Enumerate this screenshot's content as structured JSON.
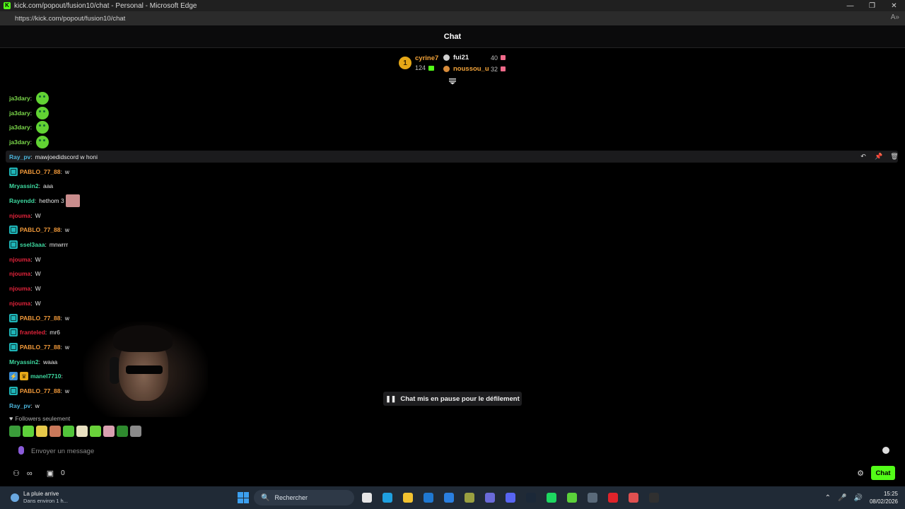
{
  "window": {
    "title": "kick.com/popout/fusion10/chat - Personal - Microsoft Edge",
    "favicon_letter": "K",
    "controls": [
      "—",
      "❐",
      "✕"
    ]
  },
  "address_bar": {
    "url": "https://kick.com/popout/fusion10/chat",
    "reader_icon": "A»"
  },
  "chat_header": {
    "title": "Chat"
  },
  "leaderboard": {
    "first": {
      "rank": "1",
      "name": "cyrine7",
      "count": "124"
    },
    "others": [
      {
        "name": "fui21",
        "count": "40",
        "icon_color": "#cfcfcf"
      },
      {
        "name": "noussou_u",
        "count": "32",
        "icon_color": "#d98c3a"
      }
    ]
  },
  "messages": [
    {
      "user": "ja3dary",
      "color": "#7bd84a",
      "badges": [],
      "text": "",
      "emote": "frog"
    },
    {
      "user": "ja3dary",
      "color": "#7bd84a",
      "badges": [],
      "text": "",
      "emote": "frog"
    },
    {
      "user": "ja3dary",
      "color": "#7bd84a",
      "badges": [],
      "text": "",
      "emote": "frog"
    },
    {
      "user": "ja3dary",
      "color": "#7bd84a",
      "badges": [],
      "text": "",
      "emote": "frog"
    },
    {
      "user": "Ray_pv",
      "color": "#4ab3d9",
      "badges": [],
      "text": "mawjoedidscord w honi",
      "emote": ""
    },
    {
      "user": "PABLO_77_88",
      "color": "#f29a3a",
      "badges": [
        "sub"
      ],
      "text": "w",
      "emote": ""
    },
    {
      "user": "Mryassin2",
      "color": "#3ed9a0",
      "badges": [],
      "text": "aaa",
      "emote": ""
    },
    {
      "user": "Rayendd",
      "color": "#3ed9a0",
      "badges": [],
      "text": "hethom 3",
      "emote": "pink"
    },
    {
      "user": "njouma",
      "color": "#e0233a",
      "badges": [],
      "text": "W",
      "emote": ""
    },
    {
      "user": "PABLO_77_88",
      "color": "#f29a3a",
      "badges": [
        "sub"
      ],
      "text": "w",
      "emote": ""
    },
    {
      "user": "ssel3aaa",
      "color": "#3ed9a0",
      "badges": [
        "sub"
      ],
      "text": "mnwrrr",
      "emote": ""
    },
    {
      "user": "njouma",
      "color": "#e0233a",
      "badges": [],
      "text": "W",
      "emote": ""
    },
    {
      "user": "njouma",
      "color": "#e0233a",
      "badges": [],
      "text": "W",
      "emote": ""
    },
    {
      "user": "njouma",
      "color": "#e0233a",
      "badges": [],
      "text": "W",
      "emote": ""
    },
    {
      "user": "njouma",
      "color": "#e0233a",
      "badges": [],
      "text": "W",
      "emote": ""
    },
    {
      "user": "PABLO_77_88",
      "color": "#f29a3a",
      "badges": [
        "sub"
      ],
      "text": "w",
      "emote": ""
    },
    {
      "user": "franteled",
      "color": "#e0233a",
      "badges": [
        "sub"
      ],
      "text": "mr6",
      "emote": ""
    },
    {
      "user": "PABLO_77_88",
      "color": "#f29a3a",
      "badges": [
        "sub"
      ],
      "text": "w",
      "emote": ""
    },
    {
      "user": "Mryassin2",
      "color": "#3ed9a0",
      "badges": [],
      "text": "waaa",
      "emote": ""
    },
    {
      "user": "manel7710",
      "color": "#3ed9a0",
      "badges": [
        "boost",
        "crown"
      ],
      "text": "",
      "emote": ""
    },
    {
      "user": "PABLO_77_88",
      "color": "#f29a3a",
      "badges": [
        "sub"
      ],
      "text": "w",
      "emote": ""
    },
    {
      "user": "Ray_pv",
      "color": "#4ab3d9",
      "badges": [],
      "text": "w",
      "emote": ""
    }
  ],
  "message_tools": [
    "↶",
    "📌",
    "🗑"
  ],
  "paused": {
    "icon": "❚❚",
    "label": "Chat mis en pause pour le défilement"
  },
  "followers": {
    "icon": "♥",
    "label": "Followers seulement"
  },
  "emote_strip_colors": [
    "#3a9c3a",
    "#5ed13a",
    "#e6c84a",
    "#c9785a",
    "#52c43a",
    "#e8e0c0",
    "#6ad13a",
    "#d9a0b0",
    "#2e8a2e",
    "#8a8a8a"
  ],
  "input": {
    "placeholder": "Envoyer un message",
    "value": ""
  },
  "bottom_bar": {
    "icon_left": "⚇",
    "infinity": "∞",
    "gift_icon": "▣",
    "gift_count": "0",
    "settings_icon": "⚙",
    "chat_button": "Chat"
  },
  "taskbar": {
    "weather": {
      "line1": "La pluie arrive",
      "line2": "Dans environ 1 h..."
    },
    "search_placeholder": "Rechercher",
    "search_icon": "🔍",
    "apps": [
      {
        "name": "task-view",
        "color": "#e6e6e6"
      },
      {
        "name": "edge",
        "color": "#1fa0e0"
      },
      {
        "name": "file-explorer",
        "color": "#f2c230"
      },
      {
        "name": "outlook",
        "color": "#1f78d1"
      },
      {
        "name": "store",
        "color": "#2a7fe0"
      },
      {
        "name": "xbox",
        "color": "#9aa040"
      },
      {
        "name": "teams",
        "color": "#6a6ad9"
      },
      {
        "name": "discord",
        "color": "#5865f2"
      },
      {
        "name": "steam",
        "color": "#1b2838"
      },
      {
        "name": "spotify",
        "color": "#1ed760"
      },
      {
        "name": "terminal",
        "color": "#5bd13a"
      },
      {
        "name": "calculator",
        "color": "#5a6a7a"
      },
      {
        "name": "opera",
        "color": "#e0232a"
      },
      {
        "name": "app-red",
        "color": "#e05050"
      },
      {
        "name": "obs",
        "color": "#303030"
      }
    ],
    "tray_icons": [
      "⌃",
      "🎤",
      "🔊"
    ],
    "time": "15:25",
    "date": "08/02/2026"
  }
}
